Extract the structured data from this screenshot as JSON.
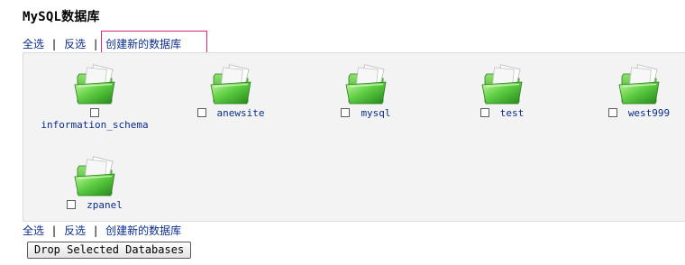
{
  "page": {
    "title": "MySQL数据库"
  },
  "links": {
    "select_all": "全选",
    "invert": "反选",
    "create": "创建新的数据库",
    "separator": "|"
  },
  "databases": [
    {
      "name": "information_schema",
      "checked": false,
      "icon": "folder-icon"
    },
    {
      "name": "anewsite",
      "checked": false,
      "icon": "folder-icon"
    },
    {
      "name": "mysql",
      "checked": false,
      "icon": "folder-icon"
    },
    {
      "name": "test",
      "checked": false,
      "icon": "folder-icon"
    },
    {
      "name": "west999",
      "checked": false,
      "icon": "folder-icon"
    },
    {
      "name": "zpanel",
      "checked": false,
      "icon": "folder-icon"
    }
  ],
  "actions": {
    "drop_label": "Drop Selected Databases"
  },
  "colors": {
    "link": "#0b2e8c",
    "highlight": "#d8277f",
    "panel_bg": "#f3f3f3",
    "folder_green": "#4cc23a"
  }
}
